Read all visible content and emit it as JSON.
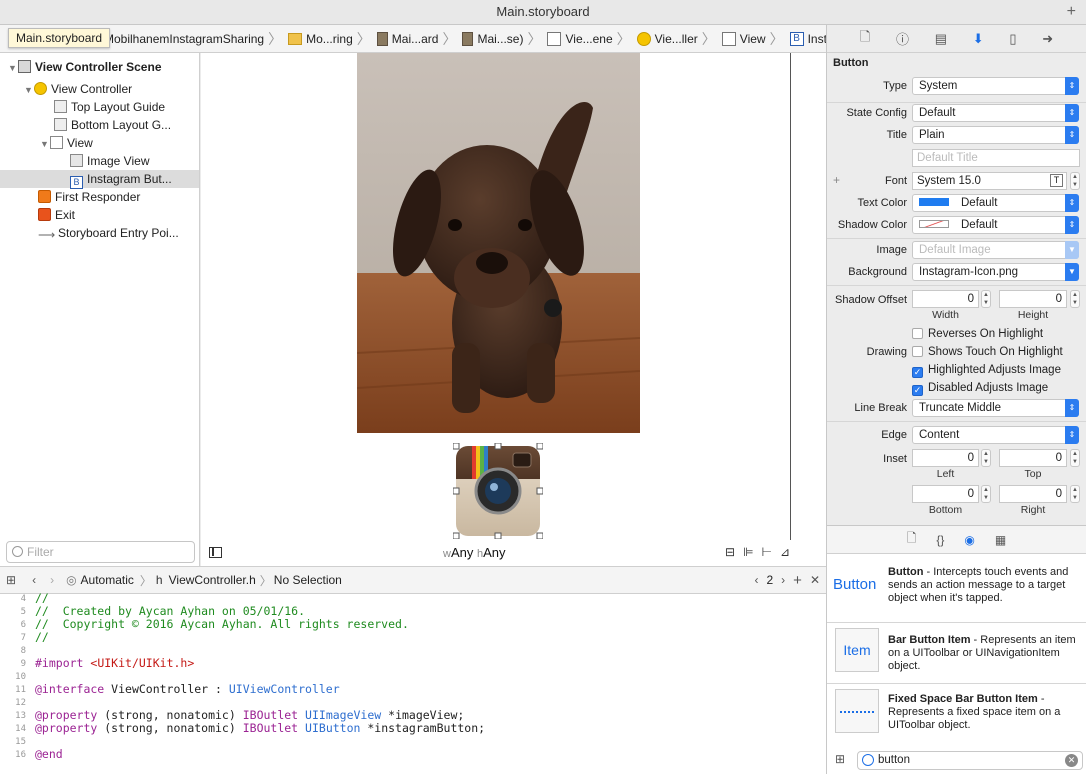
{
  "window": {
    "title": "Main.storyboard",
    "tooltip": "Main.storyboard"
  },
  "breadcrumbs": [
    "MobilhanemInstagramSharing",
    "Mo...ring",
    "Mai...ard",
    "Mai...se)",
    "Vie...ene",
    "Vie...ller",
    "View",
    "Instagram Button"
  ],
  "navigator": {
    "items": [
      {
        "label": "View Controller Scene"
      },
      {
        "label": "View Controller"
      },
      {
        "label": "Top Layout Guide"
      },
      {
        "label": "Bottom Layout G..."
      },
      {
        "label": "View"
      },
      {
        "label": "Image View"
      },
      {
        "label": "Instagram But..."
      },
      {
        "label": "First Responder"
      },
      {
        "label": "Exit"
      },
      {
        "label": "Storyboard Entry Poi..."
      }
    ],
    "filter_placeholder": "Filter"
  },
  "canvas": {
    "size_class_w_prefix": "w",
    "size_class_w": "Any",
    "size_class_h_prefix": "h",
    "size_class_h": "Any"
  },
  "editor_bar": {
    "automatic": "Automatic",
    "file": "ViewController.h",
    "selection": "No Selection",
    "counterpart": "2"
  },
  "code": {
    "lines": [
      {
        "n": "4",
        "t": "//"
      },
      {
        "n": "5",
        "t": "//  Created by Aycan Ayhan on 05/01/16."
      },
      {
        "n": "6",
        "t": "//  Copyright © 2016 Aycan Ayhan. All rights reserved."
      },
      {
        "n": "7",
        "t": "//"
      },
      {
        "n": "8",
        "t": ""
      },
      {
        "n": "9",
        "t": "#import <UIKit/UIKit.h>"
      },
      {
        "n": "10",
        "t": ""
      },
      {
        "n": "11",
        "t": "@interface ViewController : UIViewController"
      },
      {
        "n": "12",
        "t": ""
      },
      {
        "n": "13",
        "t": "@property (strong, nonatomic) IBOutlet UIImageView *imageView;"
      },
      {
        "n": "14",
        "t": "@property (strong, nonatomic) IBOutlet UIButton *instagramButton;"
      },
      {
        "n": "15",
        "t": ""
      },
      {
        "n": "16",
        "t": "@end"
      }
    ]
  },
  "inspector": {
    "section": "Button",
    "type_label": "Type",
    "type_value": "System",
    "state_label": "State Config",
    "state_value": "Default",
    "title_label": "Title",
    "title_value": "Plain",
    "title_placeholder": "Default Title",
    "font_label": "Font",
    "font_value": "System 15.0",
    "text_color_label": "Text Color",
    "text_color_value": "Default",
    "shadow_color_label": "Shadow Color",
    "shadow_color_value": "Default",
    "image_label": "Image",
    "image_placeholder": "Default Image",
    "background_label": "Background",
    "background_value": "Instagram-Icon.png",
    "shadow_offset_label": "Shadow Offset",
    "shadow_w": "0",
    "shadow_h": "0",
    "width_label": "Width",
    "height_label": "Height",
    "drawing_label": "Drawing",
    "checks": [
      {
        "label": "Reverses On Highlight",
        "checked": false
      },
      {
        "label": "Shows Touch On Highlight",
        "checked": false
      },
      {
        "label": "Highlighted Adjusts Image",
        "checked": true
      },
      {
        "label": "Disabled Adjusts Image",
        "checked": true
      }
    ],
    "line_break_label": "Line Break",
    "line_break_value": "Truncate Middle",
    "edge_label": "Edge",
    "edge_value": "Content",
    "inset_label": "Inset",
    "inset_left": "0",
    "inset_top": "0",
    "inset_bottom": "0",
    "inset_right": "0",
    "left_label": "Left",
    "top_label": "Top",
    "bottom_label": "Bottom",
    "right_label": "Right",
    "text_color_swatch": "#1f7cf0"
  },
  "library": {
    "items": [
      {
        "icon_text": "Button",
        "name": "Button",
        "desc": " - Intercepts touch events and sends an action message to a target object when it's tapped."
      },
      {
        "icon_text": "Item",
        "name": "Bar Button Item",
        "desc": " - Represents an item on a UIToolbar or UINavigationItem object."
      },
      {
        "icon_text": "",
        "name": "Fixed Space Bar Button Item",
        "desc": " - Represents a fixed space item on a UIToolbar object."
      }
    ],
    "search_value": "button"
  }
}
